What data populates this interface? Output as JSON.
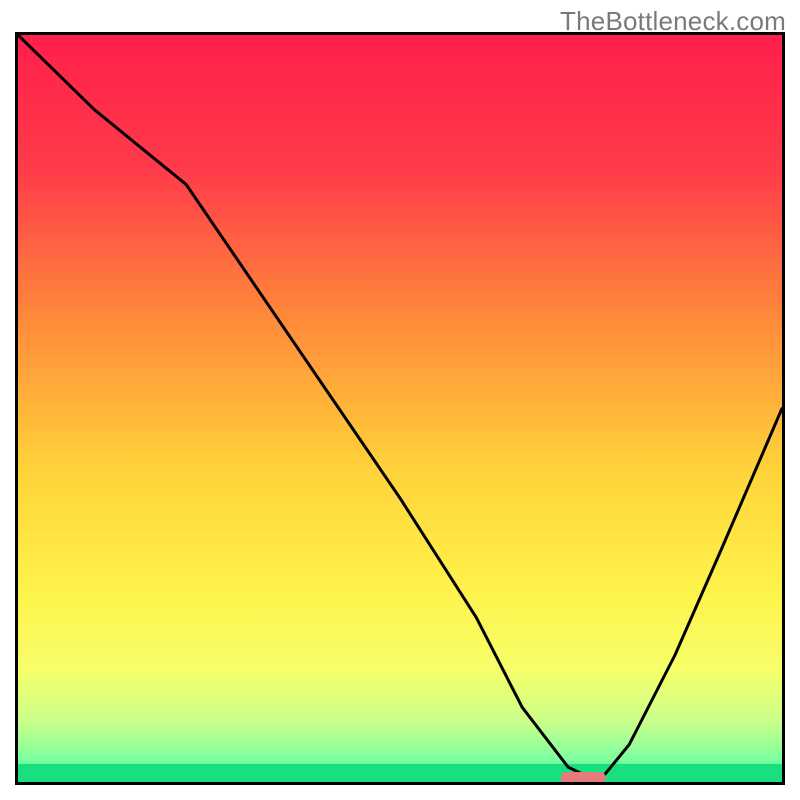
{
  "watermark": {
    "text": "TheBottleneck.com"
  },
  "chart_data": {
    "type": "line",
    "title": "",
    "xlabel": "",
    "ylabel": "",
    "xlim": [
      0,
      100
    ],
    "ylim": [
      0,
      100
    ],
    "x": [
      0,
      10,
      22,
      30,
      40,
      50,
      60,
      66,
      72,
      76,
      80,
      86,
      92,
      100
    ],
    "values": [
      100,
      90,
      80,
      68,
      53,
      38,
      22,
      10,
      2,
      0,
      5,
      17,
      31,
      50
    ],
    "optimum_x": 74,
    "marker": {
      "x": 74,
      "y": 0,
      "width_pct": 5.8,
      "height_pct": 1.6
    },
    "background_gradient_stops": [
      {
        "pct": 0,
        "color": "#ff1f4b"
      },
      {
        "pct": 18,
        "color": "#ff3b4a"
      },
      {
        "pct": 38,
        "color": "#ff8a3a"
      },
      {
        "pct": 58,
        "color": "#ffd23a"
      },
      {
        "pct": 74,
        "color": "#fff24a"
      },
      {
        "pct": 85,
        "color": "#f6ff6a"
      },
      {
        "pct": 92,
        "color": "#c9ff8a"
      },
      {
        "pct": 97,
        "color": "#7dffa0"
      },
      {
        "pct": 100,
        "color": "#19e07f"
      }
    ],
    "green_band_height_pct": 2.4,
    "green_band_color": "#19e07f",
    "curve_stroke": "#000000",
    "curve_stroke_width": 3
  }
}
